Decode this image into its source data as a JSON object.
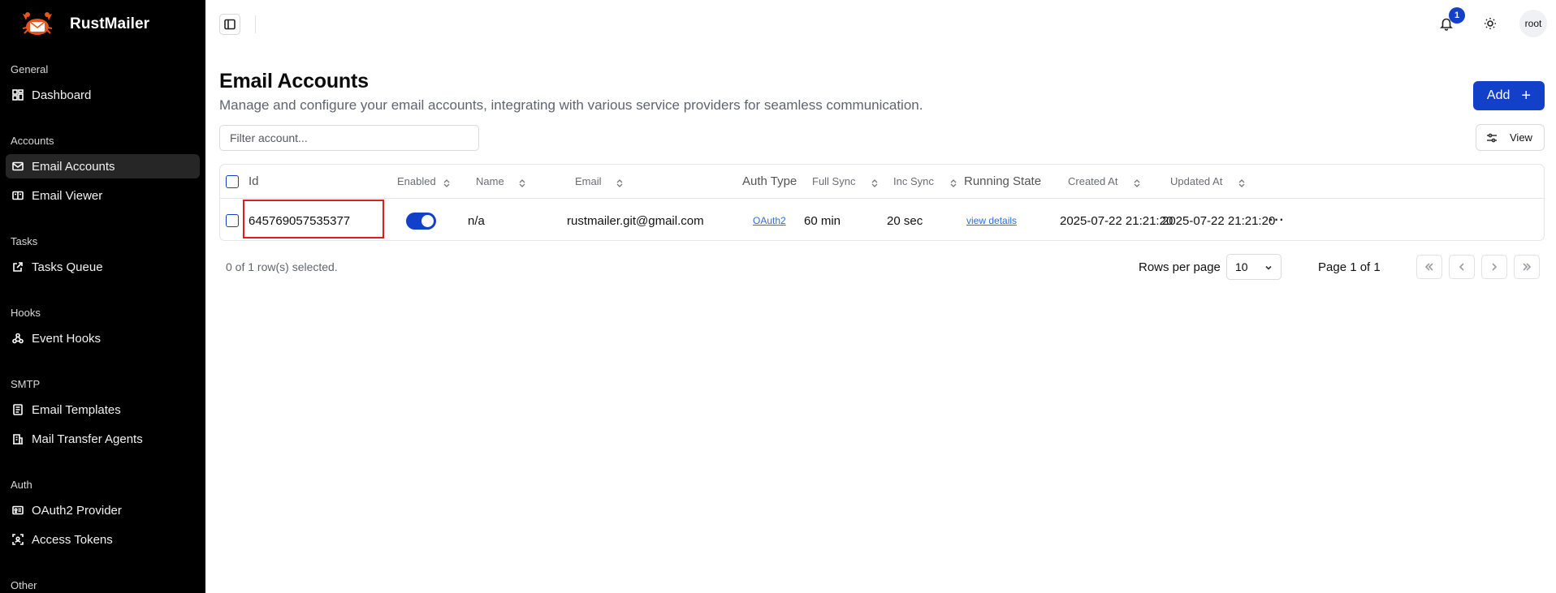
{
  "brand": {
    "name": "RustMailer"
  },
  "sidebar": {
    "sections": [
      {
        "heading": "General",
        "items": [
          {
            "label": "Dashboard",
            "icon": "dashboard-icon"
          }
        ]
      },
      {
        "heading": "Accounts",
        "items": [
          {
            "label": "Email Accounts",
            "icon": "mail-icon",
            "active": true
          },
          {
            "label": "Email Viewer",
            "icon": "email-viewer-icon"
          }
        ]
      },
      {
        "heading": "Tasks",
        "items": [
          {
            "label": "Tasks Queue",
            "icon": "external-link-icon"
          }
        ]
      },
      {
        "heading": "Hooks",
        "items": [
          {
            "label": "Event Hooks",
            "icon": "webhook-icon"
          }
        ]
      },
      {
        "heading": "SMTP",
        "items": [
          {
            "label": "Email Templates",
            "icon": "template-icon"
          },
          {
            "label": "Mail Transfer Agents",
            "icon": "building-icon"
          }
        ]
      },
      {
        "heading": "Auth",
        "items": [
          {
            "label": "OAuth2 Provider",
            "icon": "id-card-icon"
          },
          {
            "label": "Access Tokens",
            "icon": "token-scan-icon"
          }
        ]
      },
      {
        "heading": "Other",
        "items": []
      }
    ]
  },
  "topbar": {
    "notification_count": "1",
    "user": "root"
  },
  "header": {
    "title": "Email Accounts",
    "subtitle": "Manage and configure your email accounts, integrating with various service providers for seamless communication.",
    "add_label": "Add",
    "filter_placeholder": "Filter account...",
    "view_label": "View"
  },
  "table": {
    "columns": [
      "Id",
      "Enabled",
      "Name",
      "Email",
      "Auth Type",
      "Full Sync",
      "Inc Sync",
      "Running State",
      "Created At",
      "Updated At"
    ],
    "rows": [
      {
        "id": "645769057535377",
        "enabled": true,
        "name": "n/a",
        "email": "rustmailer.git@gmail.com",
        "auth_type": "OAuth2",
        "full_sync": "60 min",
        "inc_sync": "20 sec",
        "running_state": "view details",
        "created_at": "2025-07-22 21:21:20",
        "updated_at": "2025-07-22 21:21:20"
      }
    ]
  },
  "footer": {
    "selected": "0 of 1 row(s) selected.",
    "rows_per_page_label": "Rows per page",
    "rows_per_page": "10",
    "page_info": "Page 1 of 1"
  },
  "colors": {
    "accent": "#1340c8",
    "sidebar_bg": "#000000",
    "highlight": "#e01c1c"
  }
}
